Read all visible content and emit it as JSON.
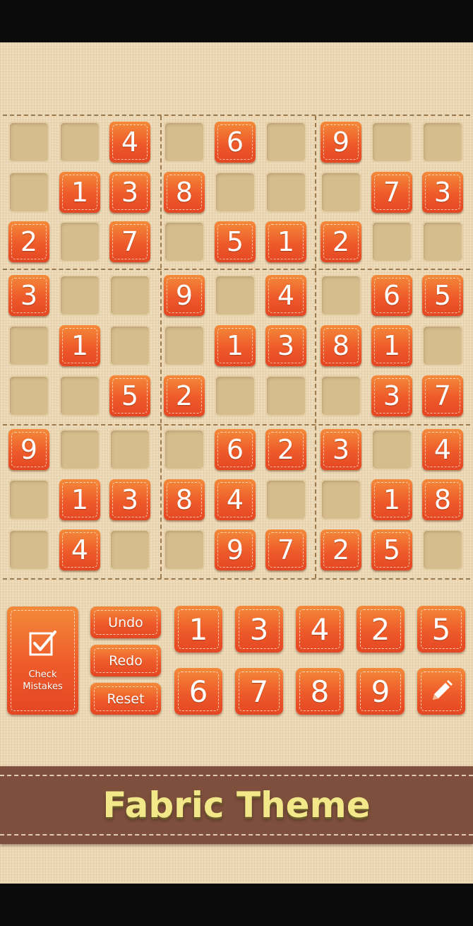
{
  "grid": [
    [
      0,
      0,
      4,
      0,
      6,
      0,
      9,
      0,
      0
    ],
    [
      0,
      1,
      3,
      8,
      0,
      0,
      0,
      7,
      3
    ],
    [
      2,
      0,
      7,
      0,
      5,
      1,
      2,
      0,
      0
    ],
    [
      3,
      0,
      0,
      9,
      0,
      4,
      0,
      6,
      5
    ],
    [
      0,
      1,
      0,
      0,
      1,
      3,
      8,
      1,
      0
    ],
    [
      0,
      0,
      5,
      2,
      0,
      0,
      0,
      3,
      7
    ],
    [
      9,
      0,
      0,
      0,
      6,
      2,
      3,
      0,
      4
    ],
    [
      0,
      1,
      3,
      8,
      4,
      0,
      0,
      1,
      8
    ],
    [
      0,
      4,
      0,
      0,
      9,
      7,
      2,
      5,
      0
    ]
  ],
  "controls": {
    "check_line1": "Check",
    "check_line2": "Mistakes",
    "undo": "Undo",
    "redo": "Redo",
    "reset": "Reset"
  },
  "number_pad": [
    "1",
    "3",
    "4",
    "2",
    "5",
    "6",
    "7",
    "8",
    "9"
  ],
  "pencil_icon": "pencil-icon",
  "checkbox_icon": "checkbox-icon",
  "banner": {
    "title": "Fabric Theme"
  },
  "colors": {
    "tile_orange": "#ee5a2a",
    "empty_cell": "#d6bd8e",
    "background": "#eedcba",
    "banner": "#7d4f3c",
    "banner_text": "#f3e889"
  }
}
